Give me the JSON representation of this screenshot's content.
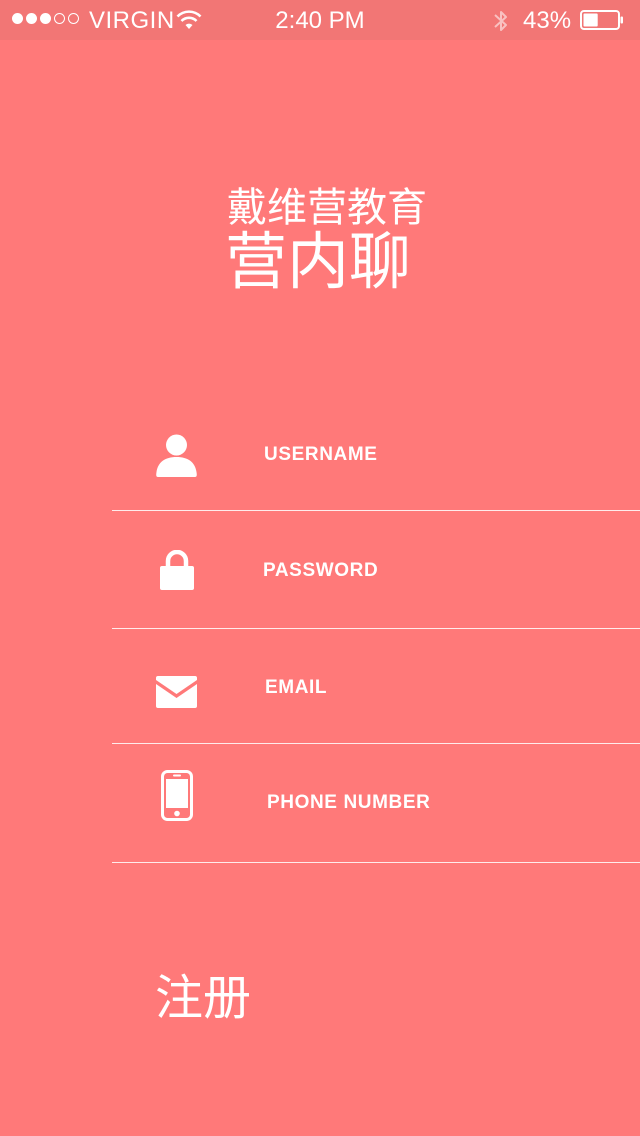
{
  "status_bar": {
    "carrier": "VIRGIN",
    "time": "2:40 PM",
    "battery_percent": "43%",
    "battery_level": 0.43,
    "signal_bars_filled": 3,
    "signal_bars_total": 5
  },
  "brand": {
    "subtitle": "戴维营教育",
    "title": "营内聊"
  },
  "form": {
    "username_label": "USERNAME",
    "password_label": "PASSWORD",
    "email_label": "EMAIL",
    "phone_label": "PHONE NUMBER"
  },
  "register_label": "注册",
  "colors": {
    "background": "#ff7979",
    "status_bar": "#f27675",
    "foreground": "#ffffff"
  },
  "icons": {
    "username": "user-icon",
    "password": "lock-icon",
    "email": "envelope-icon",
    "phone": "phone-icon"
  }
}
